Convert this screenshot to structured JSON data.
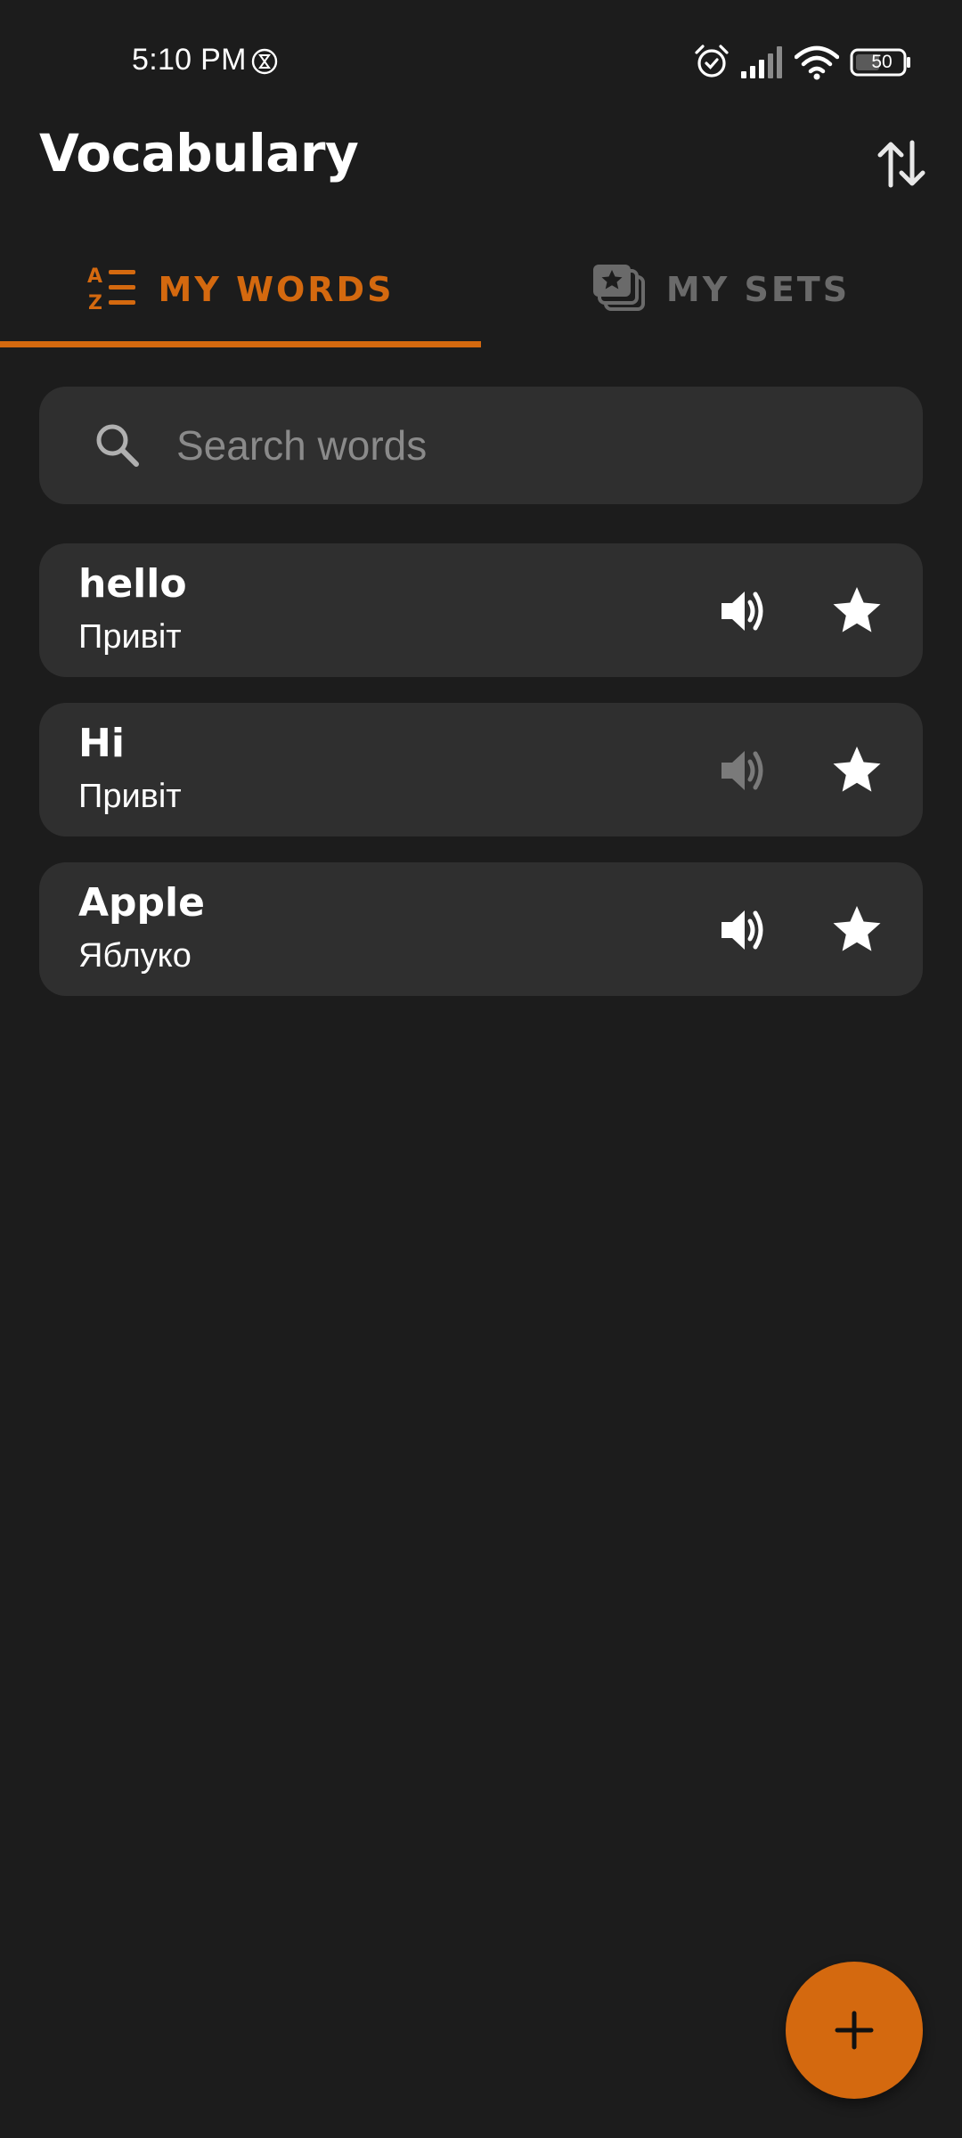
{
  "status_bar": {
    "time": "5:10 PM",
    "battery_level": "50",
    "icons": [
      "hourglass-icon",
      "alarm-icon",
      "signal-icon",
      "wifi-icon",
      "battery-icon"
    ]
  },
  "header": {
    "title": "Vocabulary",
    "sort_icon": "sort-arrows-icon"
  },
  "tabs": [
    {
      "label": "MY WORDS",
      "icon": "az-list-icon",
      "active": true
    },
    {
      "label": "MY SETS",
      "icon": "card-stack-star-icon",
      "active": false
    }
  ],
  "search": {
    "placeholder": "Search words",
    "value": ""
  },
  "words": [
    {
      "term": "hello",
      "translation": "Привіт",
      "audio_available": true,
      "favorite": true
    },
    {
      "term": "Hi",
      "translation": "Привіт",
      "audio_available": false,
      "favorite": true
    },
    {
      "term": "Apple",
      "translation": "Яблуко",
      "audio_available": true,
      "favorite": true
    }
  ],
  "fab": {
    "icon": "plus-icon"
  },
  "colors": {
    "background": "#1c1c1c",
    "card": "#2f2f2f",
    "accent": "#d4690f",
    "inactive": "#6a6a6a",
    "placeholder": "#8a8a8a"
  }
}
